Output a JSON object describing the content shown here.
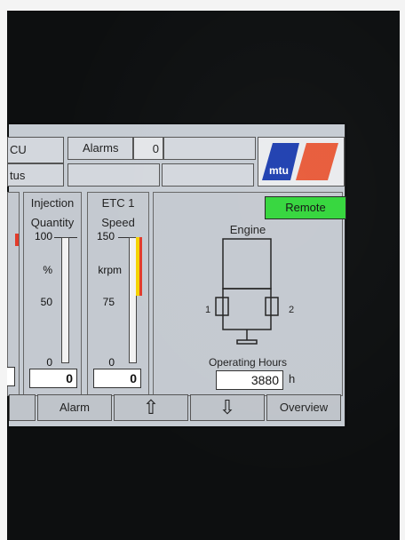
{
  "header": {
    "ecu_fragment": "CU",
    "status_fragment": "tus",
    "alarms_label": "Alarms",
    "alarms_count": "0",
    "logo_text": "mtu"
  },
  "injection_panel": {
    "title_line1": "Injection",
    "title_line2": "Quantity",
    "ticks": [
      "100",
      "%",
      "50",
      "0"
    ],
    "value": "0"
  },
  "etc_panel": {
    "title_line1": "ETC 1",
    "title_line2": "Speed",
    "ticks": [
      "150",
      "krpm",
      "75",
      "0"
    ],
    "value": "0",
    "speed_zone_colors": [
      "#f5d300",
      "#e23b2a"
    ]
  },
  "engine_panel": {
    "remote_label": "Remote",
    "engine_label": "Engine",
    "turbo_left": "1",
    "turbo_right": "2",
    "operating_hours_label": "Operating Hours",
    "operating_hours_value": "3880",
    "hours_unit": "h"
  },
  "footer": {
    "alarm_label": "Alarm",
    "up_arrow": "⇧",
    "down_arrow": "⇩",
    "overview_label": "Overview"
  },
  "colors": {
    "remote_green": "#33d63b",
    "logo_blue": "#1e3fb0",
    "logo_red": "#e85b3a"
  }
}
